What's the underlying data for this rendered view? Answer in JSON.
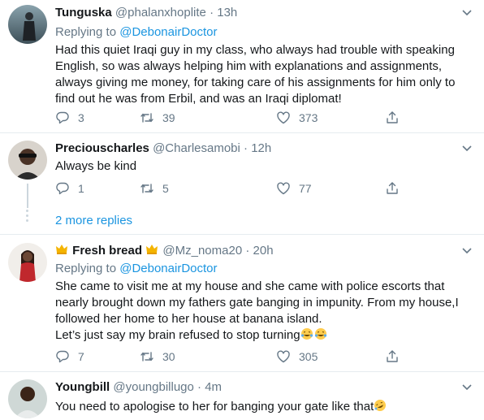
{
  "colors": {
    "accent": "#1b95e0",
    "secondary_text": "#657786",
    "border": "#e6ecf0"
  },
  "icons": [
    "reply-icon",
    "retweet-icon",
    "like-icon",
    "share-icon",
    "chevron-down-icon",
    "crown-emoji-icon",
    "tears-of-joy-emoji-icon",
    "rofl-emoji-icon"
  ],
  "tweets": [
    {
      "display_name": "Tunguska",
      "handle": "@phalanxhoplite",
      "dot": "·",
      "time": "13h",
      "replying_prefix": "Replying to",
      "replying_to": "@DebonairDoctor",
      "text": "Had this quiet Iraqi guy in my class, who always had trouble with speaking English, so was always helping him with explanations and assignments, always giving me money, for taking care of his assignments for him only to find out he was from Erbil, and was an Iraqi diplomat!",
      "replies": "3",
      "retweets": "39",
      "likes": "373"
    },
    {
      "display_name": "Preciouscharles",
      "handle": "@Charlesamobi",
      "dot": "·",
      "time": "12h",
      "text": "Always be kind",
      "replies": "1",
      "retweets": "5",
      "likes": "77"
    },
    {
      "display_name": "Fresh bread",
      "handle": "@Mz_noma20",
      "dot": "·",
      "time": "20h",
      "replying_prefix": "Replying to",
      "replying_to": "@DebonairDoctor",
      "text": "She came to visit me at my house and she came with police escorts that nearly brought down my fathers gate banging in impunity. From my house,I followed her home to her house at banana island.",
      "text2": "Let’s just say my brain refused to stop turning",
      "replies": "7",
      "retweets": "30",
      "likes": "305"
    },
    {
      "display_name": "Youngbill",
      "handle": "@youngbillugo",
      "dot": "·",
      "time": "4m",
      "text": "You need to apologise to her for banging your gate like that"
    }
  ],
  "more_replies": "2 more replies"
}
